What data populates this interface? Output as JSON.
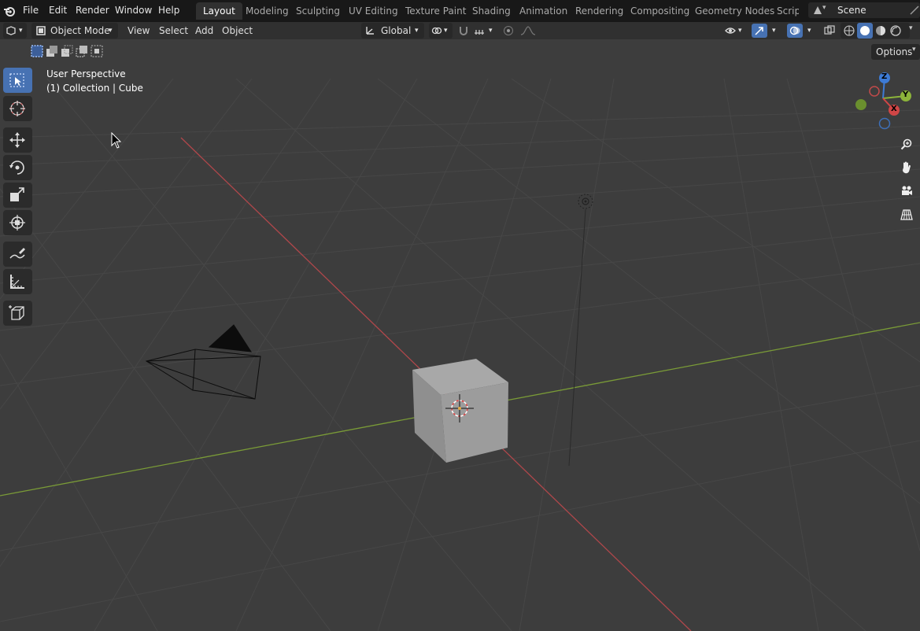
{
  "menu": [
    "File",
    "Edit",
    "Render",
    "Window",
    "Help"
  ],
  "workspaces": [
    "Layout",
    "Modeling",
    "Sculpting",
    "UV Editing",
    "Texture Paint",
    "Shading",
    "Animation",
    "Rendering",
    "Compositing",
    "Geometry Nodes",
    "Scripti"
  ],
  "active_workspace": "Layout",
  "scene_name": "Scene",
  "header": {
    "mode": "Object Mode",
    "menus": [
      "View",
      "Select",
      "Add",
      "Object"
    ],
    "transform_orientation": "Global",
    "options_label": "Options"
  },
  "viewport": {
    "perspective_label": "User Perspective",
    "collection_label": "(1) Collection | Cube"
  },
  "gizmo": {
    "z": "Z",
    "y": "Y",
    "x": "X"
  },
  "colors": {
    "accent": "#4772b3",
    "x_axis": "#d04646",
    "y_axis": "#8cb43a",
    "z_axis": "#3d7bd6"
  },
  "icons": {
    "toolbar": [
      "select-box-icon",
      "cursor-icon",
      "move-icon",
      "rotate-icon",
      "scale-icon",
      "transform-icon",
      "annotate-icon",
      "measure-icon",
      "add-cube-icon"
    ],
    "nav": [
      "zoom-icon",
      "hand-pan-icon",
      "camera-view-icon",
      "ortho-grid-icon"
    ]
  }
}
